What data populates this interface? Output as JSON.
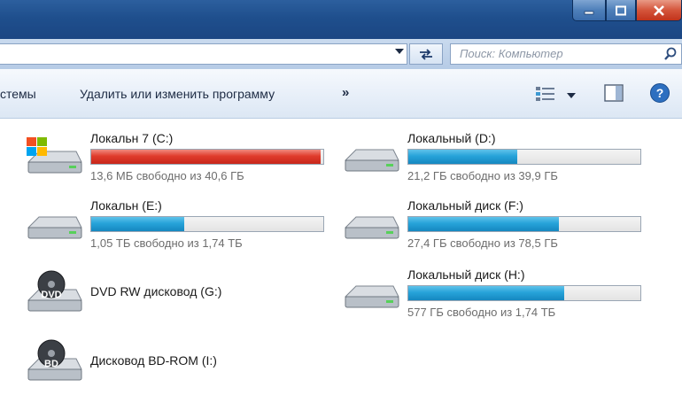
{
  "address_bar": {
    "search_placeholder": "Поиск: Компьютер"
  },
  "toolbar": {
    "system_label": "стемы",
    "uninstall_label": "Удалить или изменить программу",
    "more_label": "»"
  },
  "drives": [
    {
      "name": "Локальн 7 (C:)",
      "info": "13,6 МБ свободно из 40,6 ГБ",
      "used_fraction": 0.99,
      "bar_color": "#e03c2c",
      "icon": "windows-drive-icon"
    },
    {
      "name": "Локальный (D:)",
      "info": "21,2 ГБ свободно из 39,9 ГБ",
      "used_fraction": 0.47,
      "bar_color": "#27a3d9",
      "icon": "hard-drive-icon"
    },
    {
      "name": "Локальн (E:)",
      "info": "1,05 ТБ свободно из 1,74 ТБ",
      "used_fraction": 0.4,
      "bar_color": "#27a3d9",
      "icon": "hard-drive-icon"
    },
    {
      "name": "Локальный диск (F:)",
      "info": "27,4 ГБ свободно из 78,5 ГБ",
      "used_fraction": 0.65,
      "bar_color": "#27a3d9",
      "icon": "hard-drive-icon"
    },
    {
      "name": "DVD RW дисковод (G:)",
      "icon": "dvd-drive-icon"
    },
    {
      "name": "Локальный диск (H:)",
      "info": "577 ГБ свободно из 1,74 ТБ",
      "used_fraction": 0.67,
      "bar_color": "#27a3d9",
      "icon": "hard-drive-icon"
    },
    {
      "name": "Дисковод BD-ROM (I:)",
      "icon": "bd-drive-icon"
    }
  ],
  "icons": {
    "dvd_label": "DVD",
    "bd_label": "BD"
  }
}
